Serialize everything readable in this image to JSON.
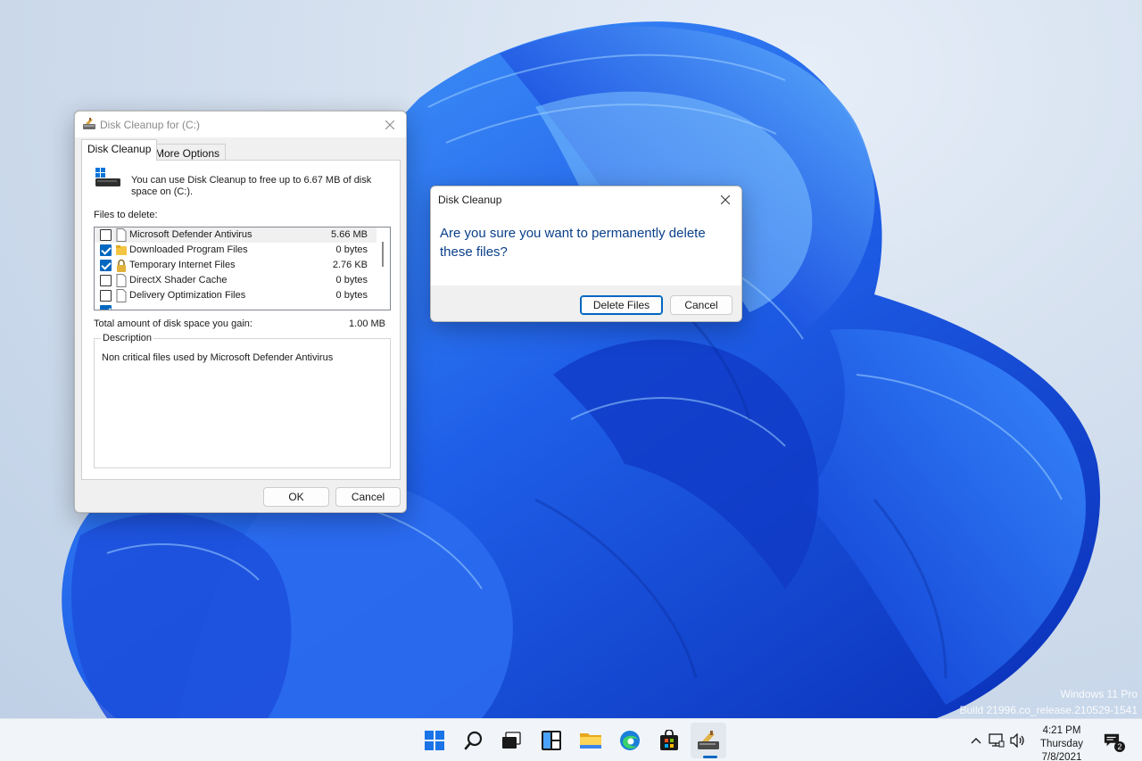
{
  "desktop": {
    "watermark_line1": "Windows 11 Pro",
    "watermark_line2": "Build 21996.co_release.210529-1541",
    "accent": "#1f55e0"
  },
  "main_window": {
    "title": "Disk Cleanup for  (C:)",
    "tabs": [
      {
        "label": "Disk Cleanup",
        "selected": true
      },
      {
        "label": "More Options",
        "selected": false
      }
    ],
    "intro": "You can use Disk Cleanup to free up to 6.67 MB of disk space on  (C:).",
    "files_label": "Files to delete:",
    "files": [
      {
        "name": "Microsoft Defender Antivirus",
        "size": "5.66 MB",
        "checked": false,
        "icon": "document-icon"
      },
      {
        "name": "Downloaded Program Files",
        "size": "0 bytes",
        "checked": true,
        "icon": "folder-icon"
      },
      {
        "name": "Temporary Internet Files",
        "size": "2.76 KB",
        "checked": true,
        "icon": "lock-icon"
      },
      {
        "name": "DirectX Shader Cache",
        "size": "0 bytes",
        "checked": false,
        "icon": "document-icon"
      },
      {
        "name": "Delivery Optimization Files",
        "size": "0 bytes",
        "checked": false,
        "icon": "document-icon"
      }
    ],
    "total_label": "Total amount of disk space you gain:",
    "total_value": "1.00 MB",
    "description_legend": "Description",
    "description_text": "Non critical files used by Microsoft Defender Antivirus",
    "ok_label": "OK",
    "cancel_label": "Cancel"
  },
  "confirm_dialog": {
    "title": "Disk Cleanup",
    "message": "Are you sure you want to permanently delete these files?",
    "delete_label": "Delete Files",
    "cancel_label": "Cancel"
  },
  "taskbar": {
    "apps": [
      "start-icon",
      "search-icon",
      "task-view-icon",
      "widgets-icon",
      "file-explorer-icon",
      "edge-icon",
      "store-icon",
      "disk-cleanup-icon"
    ],
    "active_app": "disk-cleanup-icon",
    "time": "4:21 PM",
    "day": "Thursday",
    "date": "7/8/2021",
    "notification_count": "2"
  }
}
